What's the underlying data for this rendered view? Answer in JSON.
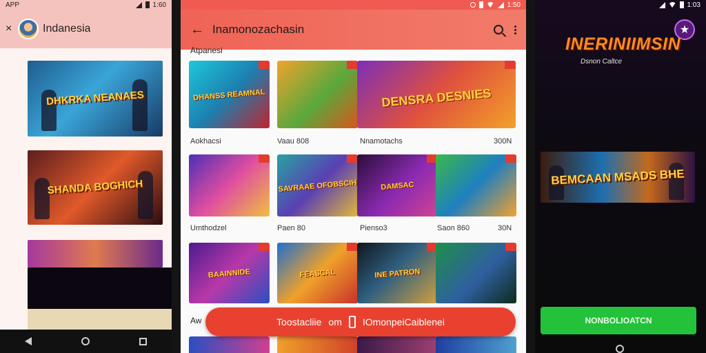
{
  "screen1": {
    "status": {
      "left": "APP",
      "time": "1:60"
    },
    "header": {
      "close": "×",
      "title": "Indanesia"
    },
    "banners": [
      {
        "text": "DHKRKA NEANAES"
      },
      {
        "text": "SHANDA BOGHICH"
      },
      {
        "text": ""
      }
    ]
  },
  "screen2": {
    "status": {
      "time": "1:50"
    },
    "header": {
      "title": "Inamonozachasin"
    },
    "sections": [
      {
        "label": "Atpanesi",
        "cards": [
          {
            "title": "DHANSS REAMNAL",
            "gradient": "linear-gradient(135deg,#1ec8d8,#1c7fb0 50%,#c0242e)"
          },
          {
            "title": "",
            "gradient": "linear-gradient(135deg,#f0a32c,#5aa83c 55%,#d9561e)"
          },
          {
            "title": "DENSRA DESNIES",
            "gradient": "linear-gradient(135deg,#7b2fb8,#e0503e 50%,#f3a12a)",
            "wide": true
          }
        ],
        "meta": [
          "Aokhacsi",
          "Vaau 808",
          "Nnamotachs",
          "300N"
        ]
      },
      {
        "label": "",
        "cards": [
          {
            "title": "",
            "gradient": "linear-gradient(135deg,#4e2fb5,#e04ea0 50%,#f0c040)"
          },
          {
            "title": "SAVRAAE OFOBSCIH",
            "gradient": "linear-gradient(135deg,#27a3a0,#5a3fb4 50%,#e2b83a)"
          },
          {
            "title": "DAMSAC",
            "gradient": "linear-gradient(135deg,#2a0e3a,#8d2ab3 55%,#d04590)"
          },
          {
            "title": "",
            "gradient": "linear-gradient(135deg,#3ab84a,#1f7fc0 50%,#f2a130)"
          }
        ],
        "meta": [
          "Umthodzel",
          "Paen 80",
          "Pienso3",
          "Saon 860",
          "30N"
        ]
      },
      {
        "label": "",
        "cards": [
          {
            "title": "BAAINNIDE",
            "gradient": "linear-gradient(135deg,#4b1c8f,#b838a8 50%,#2b4fc0)"
          },
          {
            "title": "FEASCAL",
            "gradient": "linear-gradient(135deg,#1f6fd0,#f0a12a 50%,#c8322a)"
          },
          {
            "title": "INE PATRON",
            "gradient": "linear-gradient(135deg,#11161f,#2f5f80 45%,#d0a040)"
          },
          {
            "title": "",
            "gradient": "linear-gradient(135deg,#1e8f4a,#2f5fa0 55%,#0e2b1b)"
          }
        ]
      }
    ],
    "bottom_label": "Aw",
    "fab": {
      "left": "Toostacliie",
      "mid": "om",
      "right": "IOmonpeiCaiblenei"
    }
  },
  "screen3": {
    "status": {
      "time": "1:03"
    },
    "promo_title": "INERINIIMSIN",
    "promo_sub": "Dsnon Caltce",
    "logo": "★",
    "banner": {
      "text": "BEMCAAN MSADS BHE"
    },
    "cta": "NONBOLIOATCN"
  }
}
